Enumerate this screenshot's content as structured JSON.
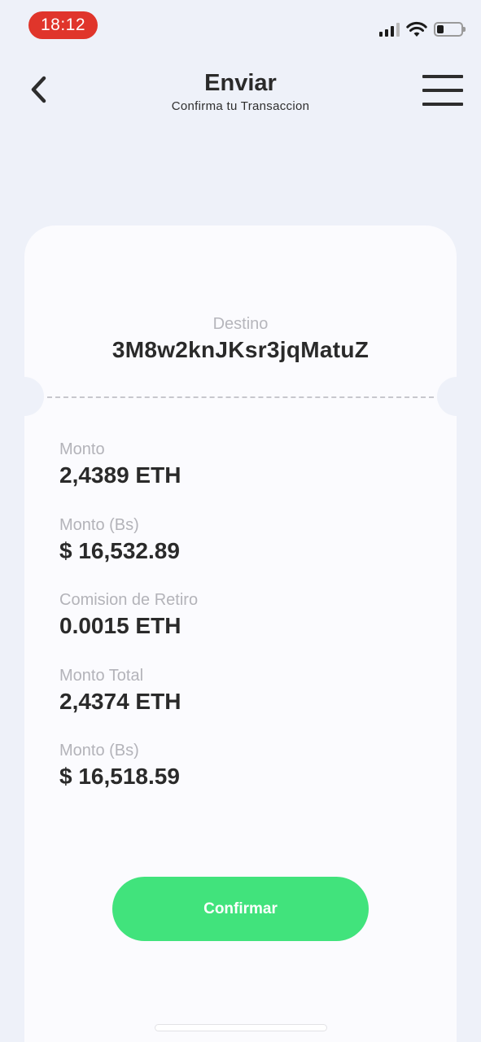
{
  "status_bar": {
    "time": "18:12",
    "time_pill_color": "#e0352b",
    "icons": [
      "signal-icon",
      "wifi-icon",
      "battery-icon"
    ]
  },
  "header": {
    "title": "Enviar",
    "subtitle": "Confirma tu Transaccion",
    "back_icon": "chevron-left-icon",
    "menu_icon": "hamburger-menu-icon"
  },
  "destination": {
    "label": "Destino",
    "address": "3M8w2knJKsr3jqMatuZ"
  },
  "details": [
    {
      "label": "Monto",
      "value": "2,4389 ETH"
    },
    {
      "label": "Monto (Bs)",
      "value": "$ 16,532.89"
    },
    {
      "label": "Comision de Retiro",
      "value": "0.0015 ETH"
    },
    {
      "label": "Monto Total",
      "value": "2,4374 ETH"
    },
    {
      "label": "Monto (Bs)",
      "value": "$ 16,518.59"
    }
  ],
  "confirm_button": {
    "label": "Confirmar",
    "color": "#41e37c"
  },
  "colors": {
    "background": "#eef1f9",
    "card": "#fbfbfe",
    "label_gray": "#b3b3b9",
    "value_dark": "#2a2a2a"
  }
}
